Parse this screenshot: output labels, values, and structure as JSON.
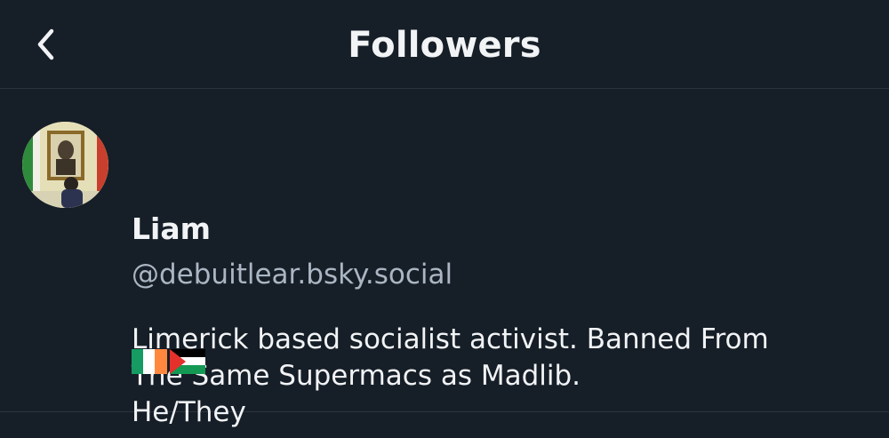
{
  "header": {
    "title": "Followers"
  },
  "follower": {
    "name": "Liam",
    "handle": "@debuitlear.bsky.social",
    "bio_lines": [
      "Limerick based socialist activist. Banned From",
      "The Same Supermacs as Madlib.",
      "He/They"
    ],
    "flags": [
      "ireland-flag-icon",
      "palestine-flag-icon"
    ]
  },
  "colors": {
    "background": "#161e27",
    "divider": "#2a343f",
    "text": "#f1f3f5",
    "handle": "#aab6c3"
  }
}
